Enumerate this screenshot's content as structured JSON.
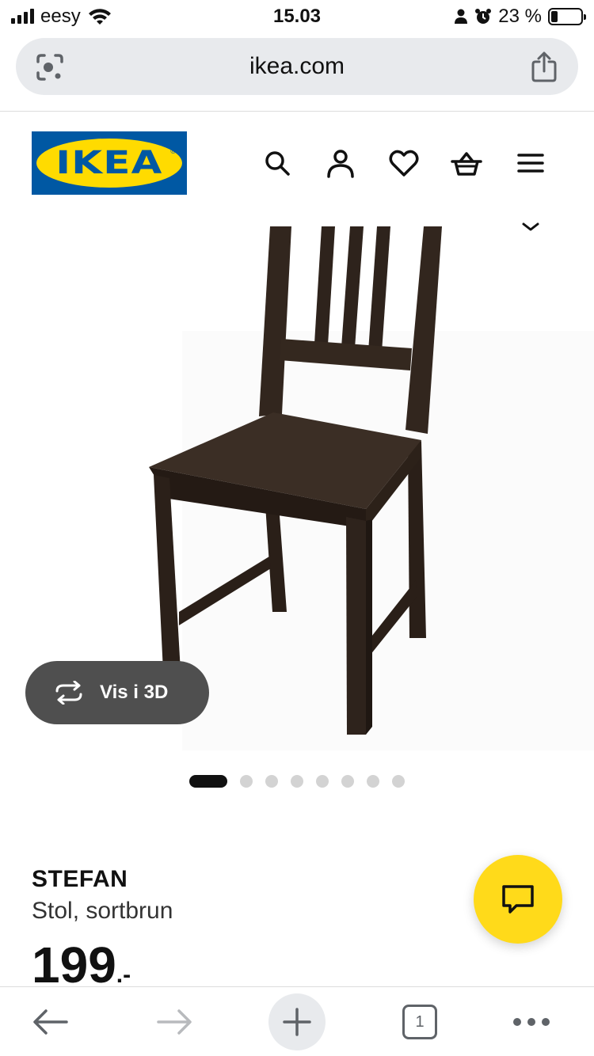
{
  "status_bar": {
    "carrier": "eesy",
    "time": "15.03",
    "battery_percent": "23 %",
    "battery_level": 0.23,
    "icons": [
      "signal-icon",
      "wifi-icon",
      "person-icon",
      "alarm-icon",
      "battery-icon"
    ]
  },
  "browser": {
    "url": "ikea.com",
    "icons": [
      "lens-icon",
      "share-icon"
    ],
    "toolbar": {
      "tab_count": "1",
      "icons": [
        "back-arrow-icon",
        "forward-arrow-icon",
        "plus-icon",
        "tabs-icon",
        "more-dots-icon"
      ]
    }
  },
  "header": {
    "logo_text": "IKEA",
    "logo_mark": "®",
    "icons": [
      "search-icon",
      "user-icon",
      "heart-icon",
      "basket-icon",
      "menu-icon"
    ]
  },
  "gallery": {
    "view_3d_label": "Vis i 3D",
    "image_count": 8,
    "active_index": 0
  },
  "product": {
    "name": "STEFAN",
    "description": "Stol, sortbrun",
    "price": "199",
    "price_suffix": ".-"
  },
  "colors": {
    "ikea_blue": "#0058a3",
    "ikea_yellow": "#ffdb00",
    "chat_button": "#ffda1a",
    "chair_brown": "#2e231c"
  }
}
